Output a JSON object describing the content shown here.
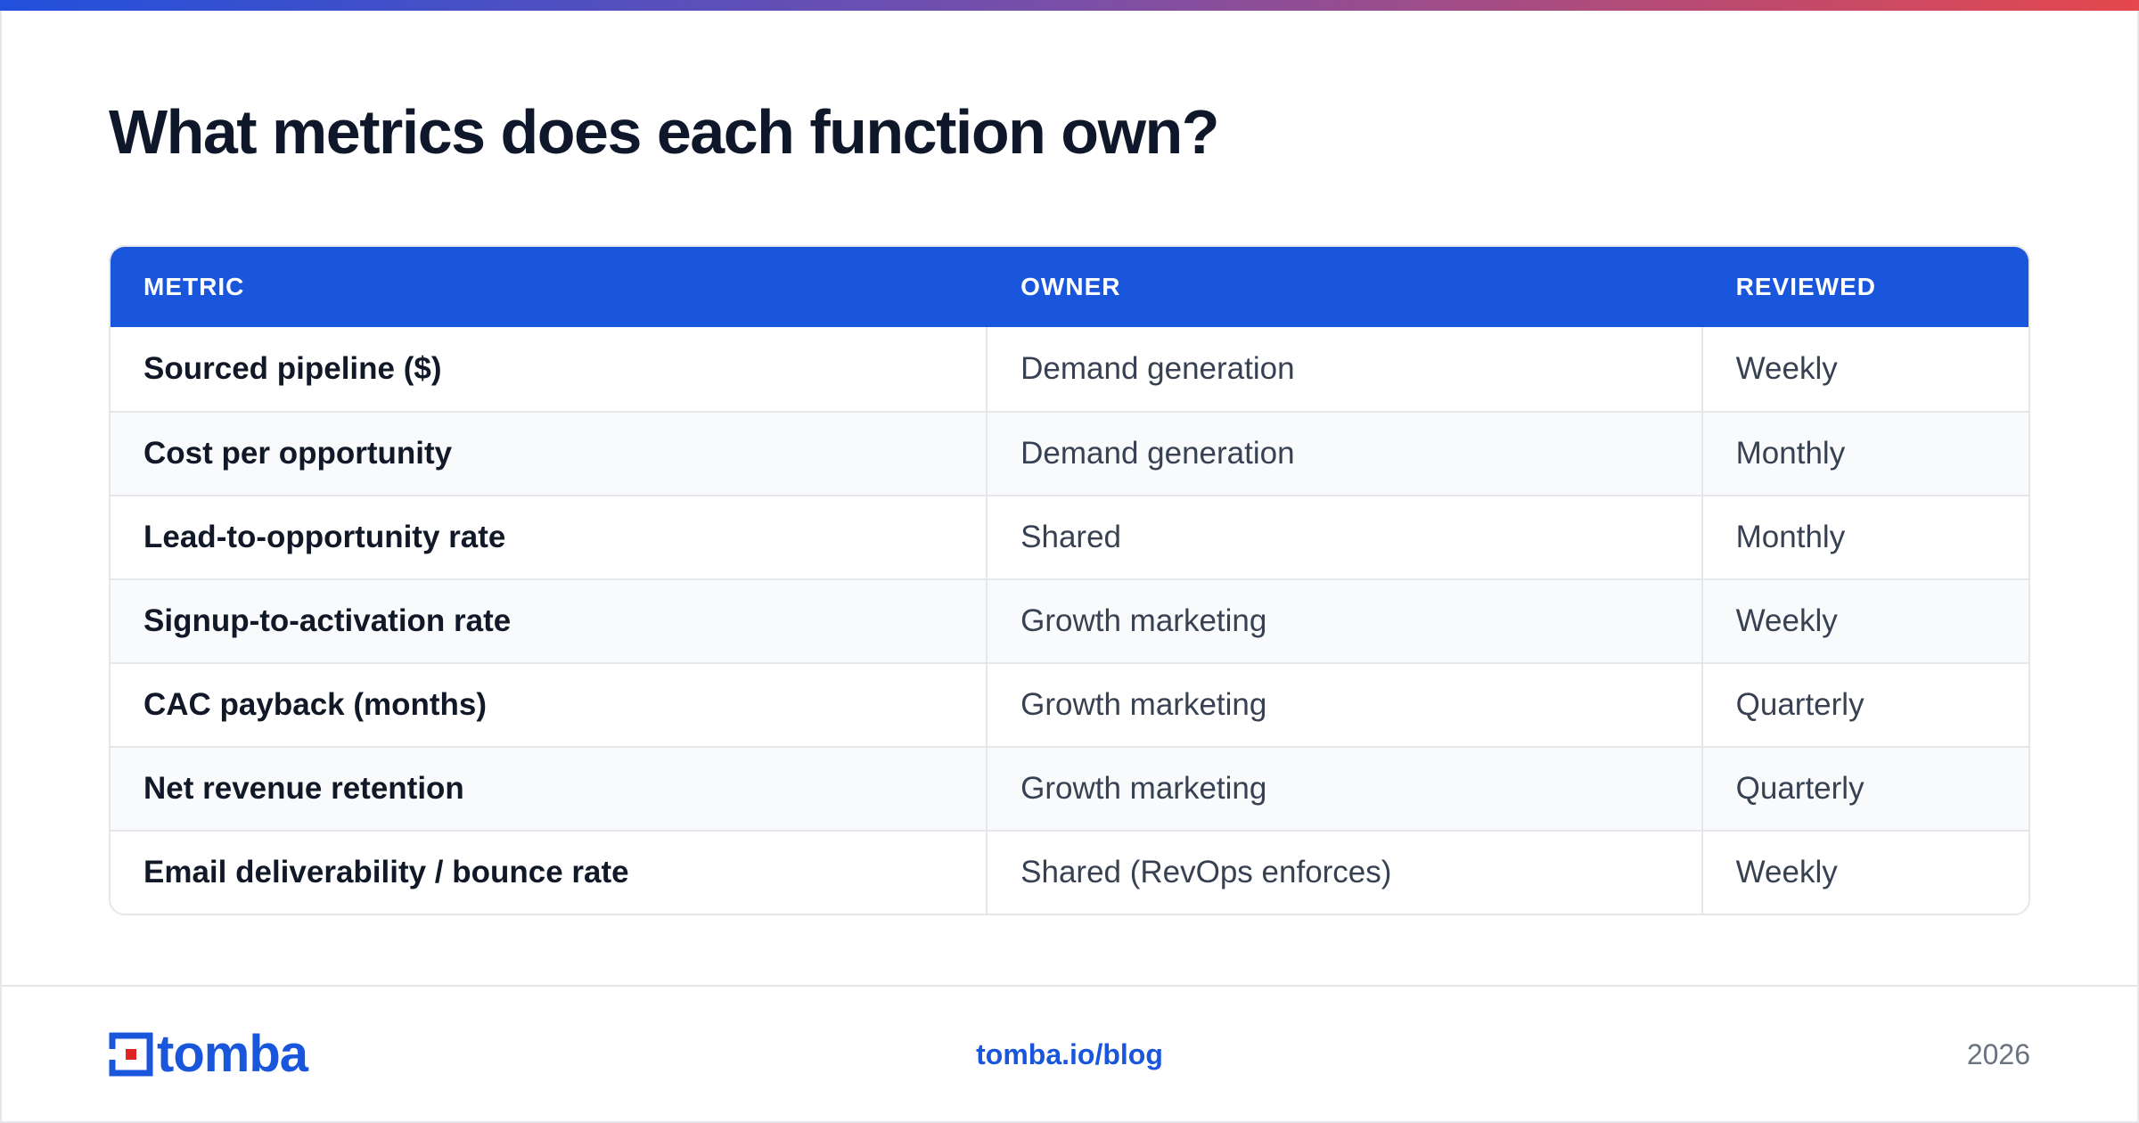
{
  "page": {
    "title": "What metrics does each function own?"
  },
  "table": {
    "headers": [
      "METRIC",
      "OWNER",
      "REVIEWED"
    ],
    "rows": [
      {
        "metric": "Sourced pipeline ($)",
        "owner": "Demand generation",
        "reviewed": "Weekly"
      },
      {
        "metric": "Cost per opportunity",
        "owner": "Demand generation",
        "reviewed": "Monthly"
      },
      {
        "metric": "Lead-to-opportunity rate",
        "owner": "Shared",
        "reviewed": "Monthly"
      },
      {
        "metric": "Signup-to-activation rate",
        "owner": "Growth marketing",
        "reviewed": "Weekly"
      },
      {
        "metric": "CAC payback (months)",
        "owner": "Growth marketing",
        "reviewed": "Quarterly"
      },
      {
        "metric": "Net revenue retention",
        "owner": "Growth marketing",
        "reviewed": "Quarterly"
      },
      {
        "metric": "Email deliverability / bounce rate",
        "owner": "Shared (RevOps enforces)",
        "reviewed": "Weekly"
      }
    ]
  },
  "footer": {
    "logo_text": "tomba",
    "link": "tomba.io/blog",
    "year": "2026"
  },
  "colors": {
    "accent": "#1a56db",
    "logo_red": "#e02424",
    "gradient_start": "#2150dc",
    "gradient_end": "#e5484d"
  },
  "icons": {
    "logo_mark": "tomba-logo-icon"
  }
}
